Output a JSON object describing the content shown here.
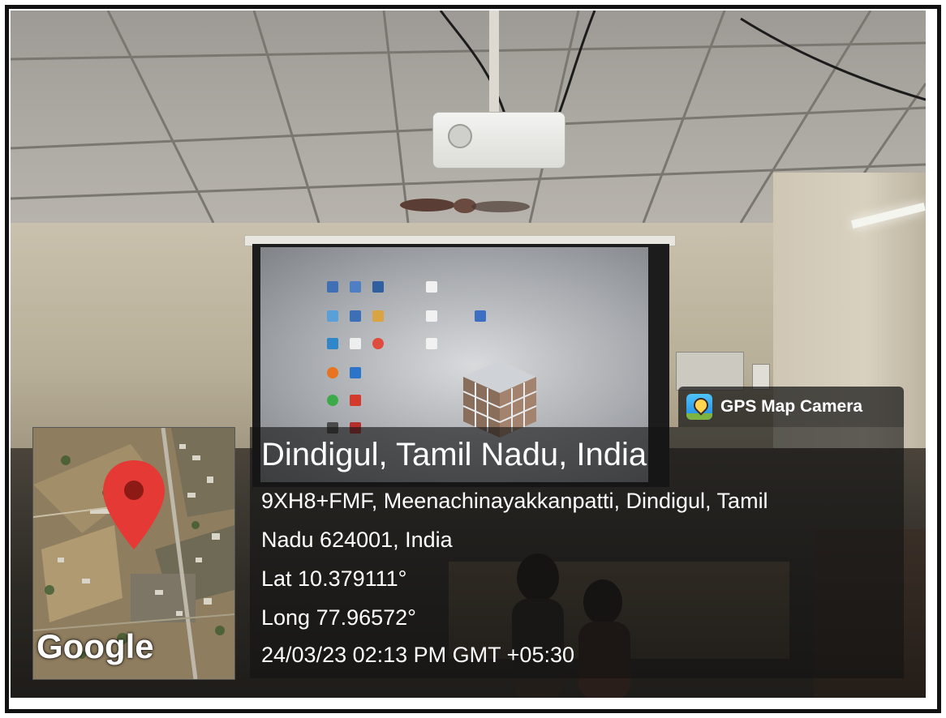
{
  "gps_badge": {
    "app_name": "GPS Map Camera",
    "icon": "gps-map-camera-logo-icon"
  },
  "location": {
    "title": "Dindigul, Tamil Nadu, India",
    "address_line1": "9XH8+FMF, Meenachinayakkanpatti, Dindigul, Tamil",
    "address_line2": "Nadu 624001, India",
    "latitude": "Lat 10.379111°",
    "longitude": "Long 77.96572°",
    "timestamp": "24/03/23 02:13 PM GMT +05:30"
  },
  "map": {
    "attribution": "Google",
    "marker_icon": "map-pin-icon",
    "marker_color": "#e53935"
  },
  "colors": {
    "frame": "#111111",
    "overlay": "#141414"
  }
}
